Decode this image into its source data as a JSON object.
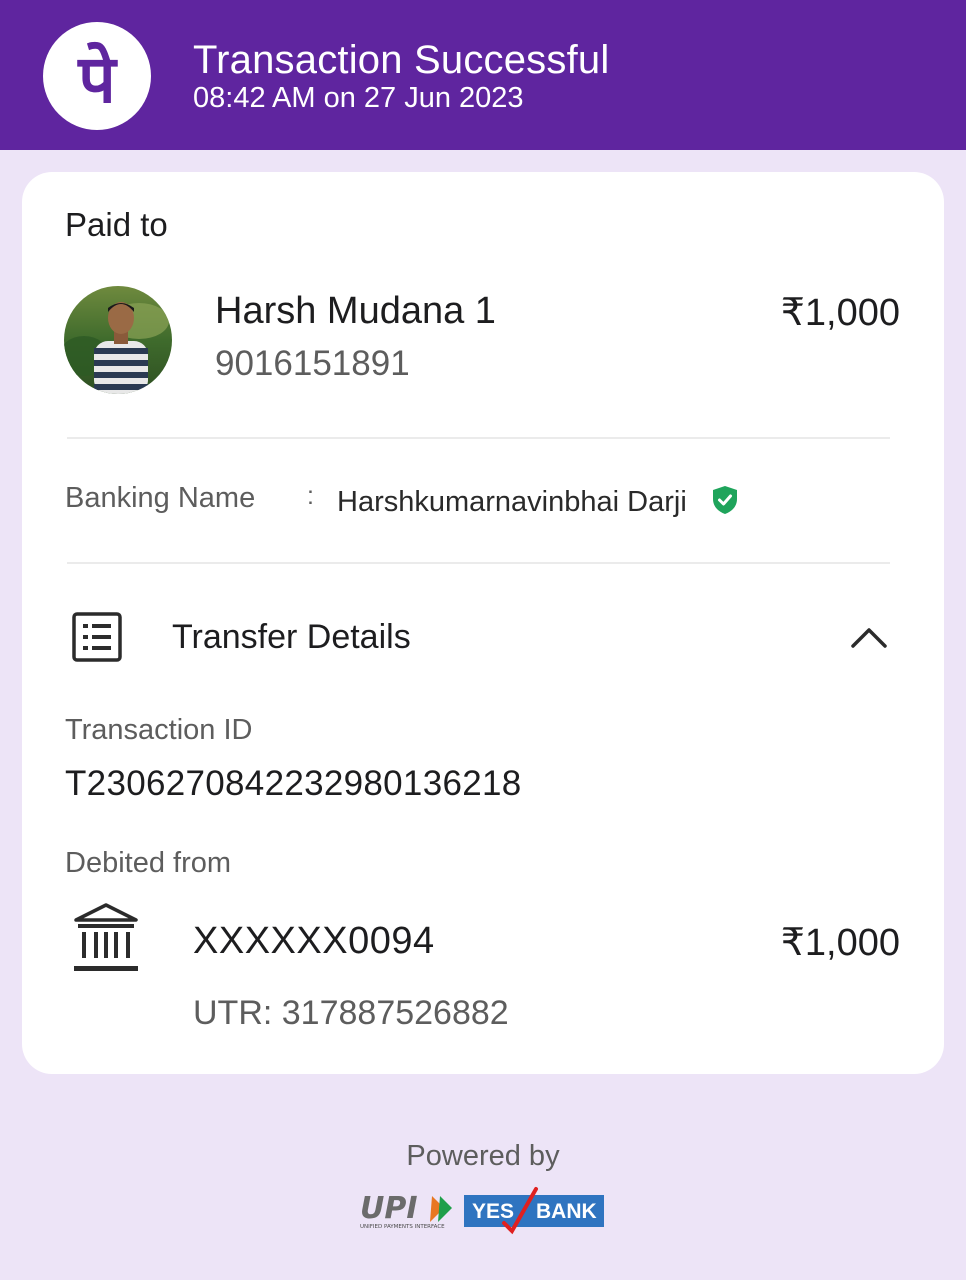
{
  "header": {
    "title": "Transaction Successful",
    "timestamp": "08:42 AM on 27 Jun 2023",
    "logo_icon": "phonepe-logo-icon",
    "brand_color": "#5f259f"
  },
  "payee": {
    "section_label": "Paid to",
    "name": "Harsh Mudana 1",
    "phone": "9016151891",
    "amount": "₹1,000"
  },
  "banking": {
    "label": "Banking Name",
    "separator": ":",
    "name": "Harshkumarnavinbhai Darji",
    "verified_icon": "verified-shield-icon",
    "verified_color": "#1fa45b"
  },
  "transfer": {
    "title": "Transfer Details",
    "expanded": true,
    "transaction_id_label": "Transaction ID",
    "transaction_id": "T2306270842232980136218",
    "debited_from_label": "Debited from",
    "account": "XXXXXX0094",
    "amount": "₹1,000",
    "utr": "UTR: 317887526882"
  },
  "footer": {
    "powered_by": "Powered by",
    "upi_text": "UPI",
    "upi_subtext": "UNIFIED PAYMENTS INTERFACE",
    "bank_logo_yes": "YES",
    "bank_logo_bank": "BANK"
  }
}
